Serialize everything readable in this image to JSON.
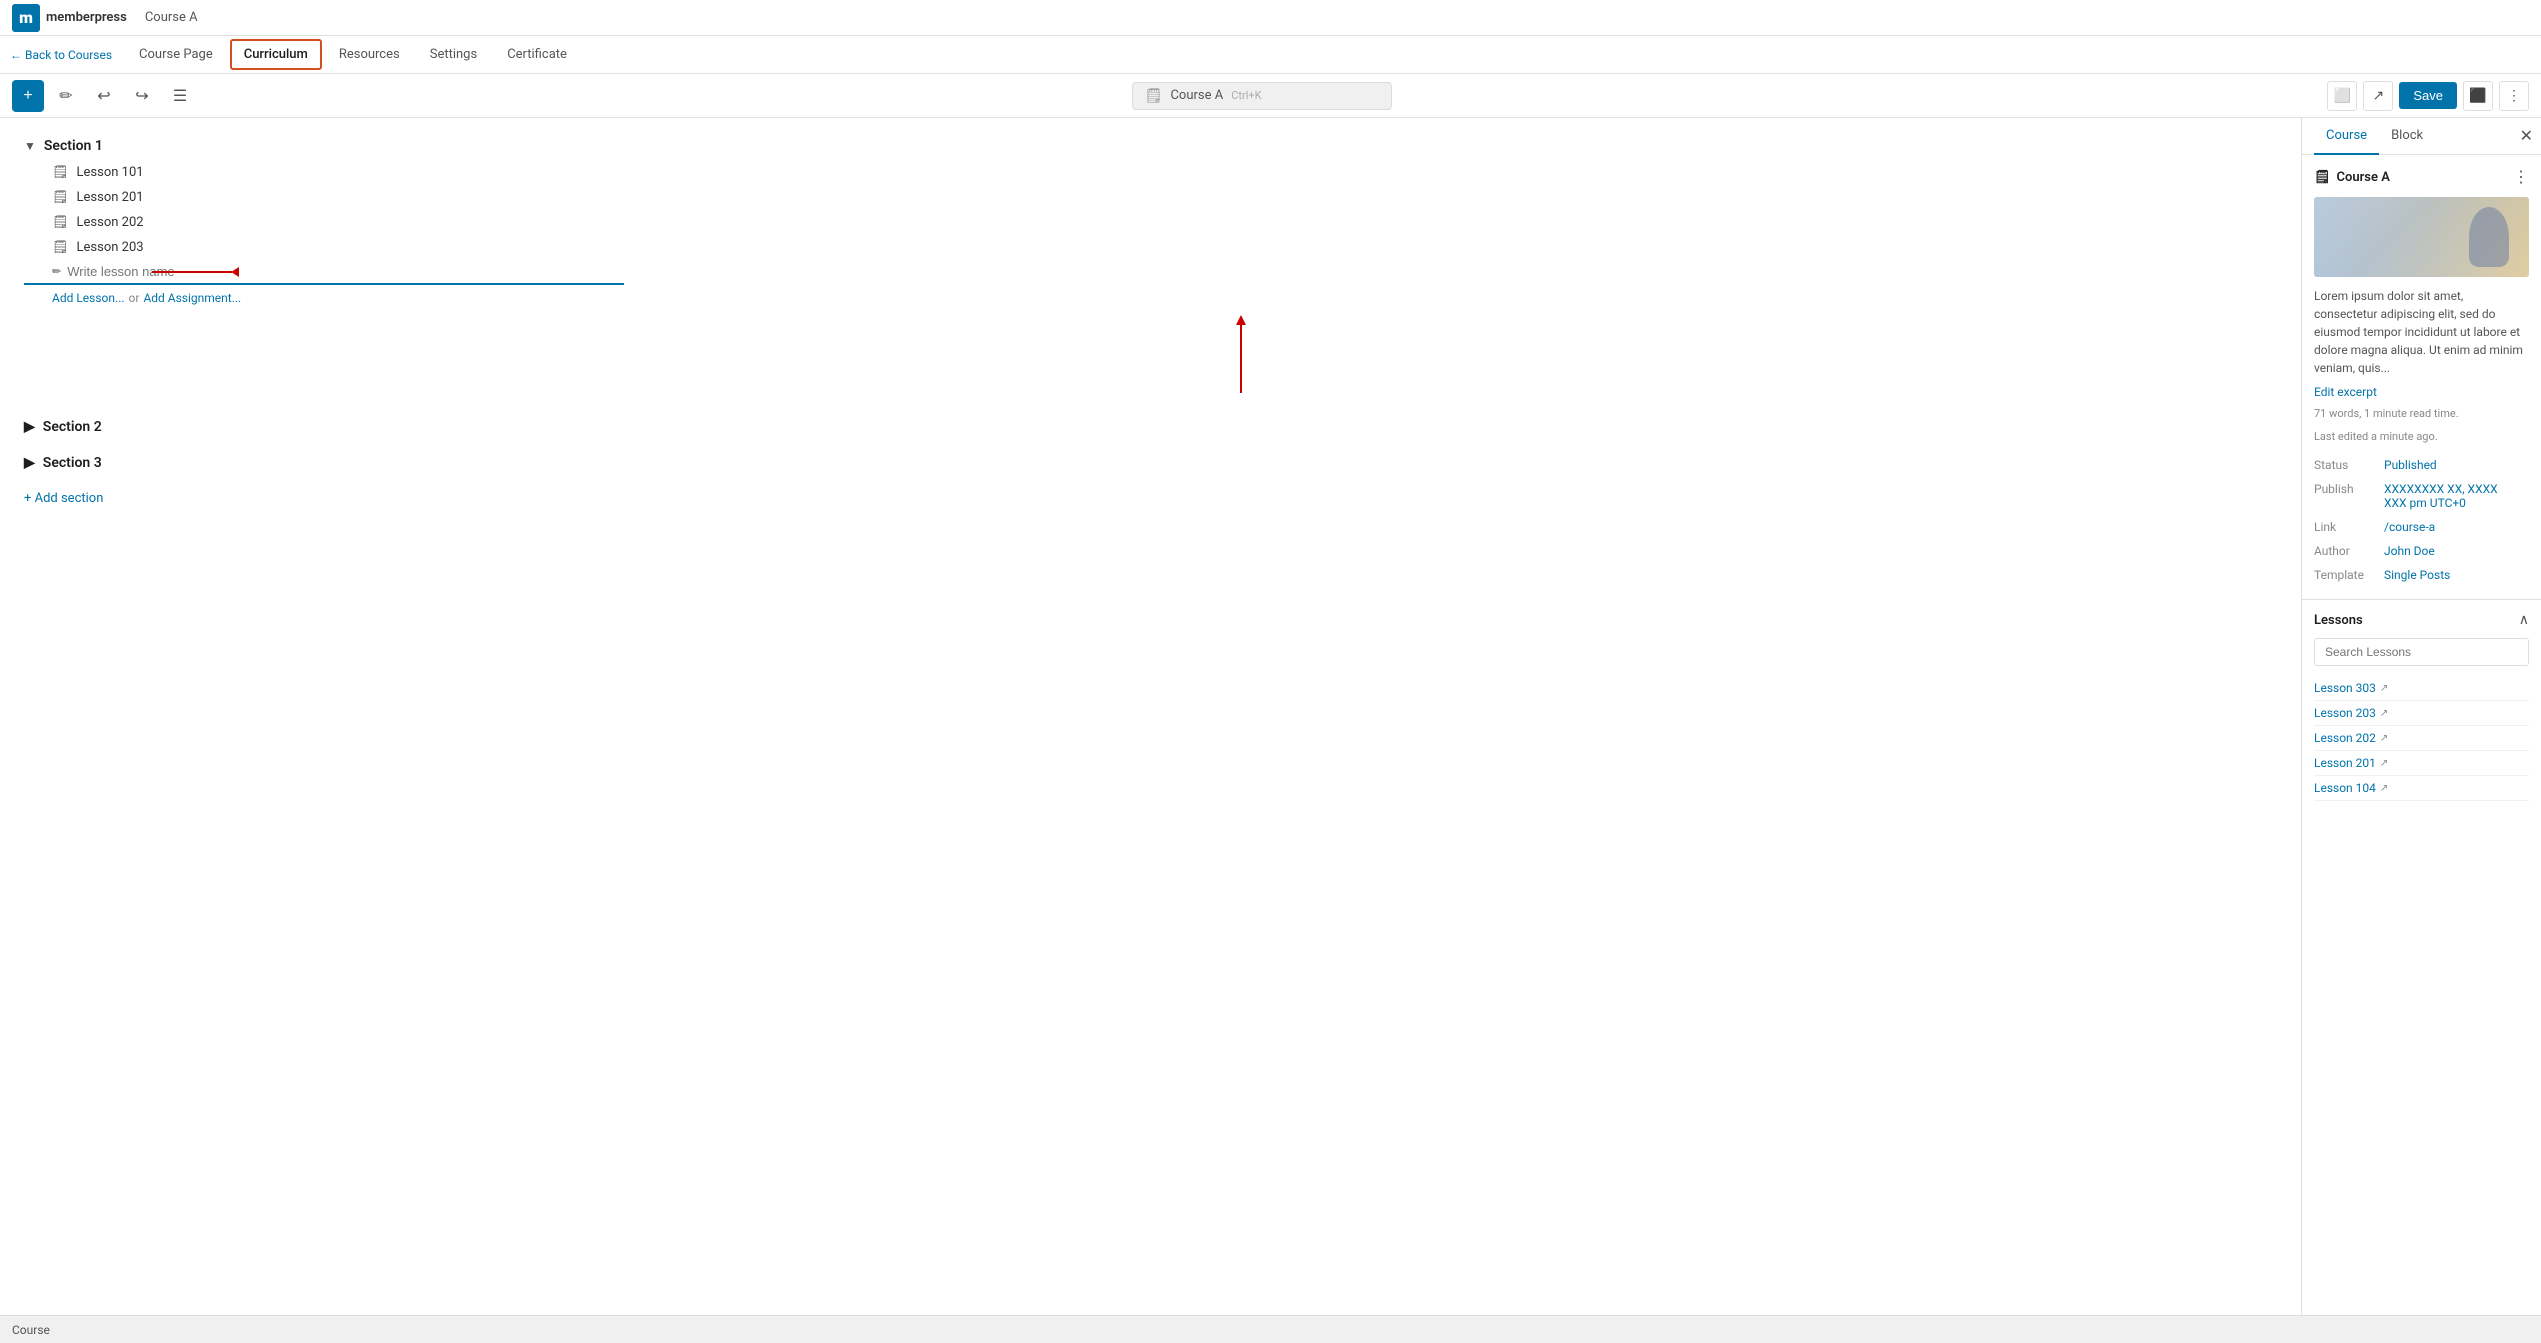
{
  "header": {
    "logo_letter": "m",
    "brand_name": "memberpress",
    "course_name": "Course A"
  },
  "nav": {
    "back_label": "← Back to Courses",
    "tabs": [
      {
        "id": "course-page",
        "label": "Course Page",
        "active": false
      },
      {
        "id": "curriculum",
        "label": "Curriculum",
        "active": true
      },
      {
        "id": "resources",
        "label": "Resources",
        "active": false
      },
      {
        "id": "settings",
        "label": "Settings",
        "active": false
      },
      {
        "id": "certificate",
        "label": "Certificate",
        "active": false
      }
    ]
  },
  "toolbar": {
    "title": "Course A",
    "shortcut": "Ctrl+K",
    "save_label": "Save"
  },
  "curriculum": {
    "sections": [
      {
        "id": "section-1",
        "label": "Section 1",
        "expanded": true,
        "lessons": [
          {
            "label": "Lesson 101"
          },
          {
            "label": "Lesson 201"
          },
          {
            "label": "Lesson 202"
          },
          {
            "label": "Lesson 203"
          }
        ],
        "new_lesson_placeholder": "Write lesson name",
        "add_lesson_label": "Add Lesson...",
        "or_label": "or",
        "add_assignment_label": "Add Assignment..."
      },
      {
        "id": "section-2",
        "label": "Section 2",
        "expanded": false,
        "lessons": []
      },
      {
        "id": "section-3",
        "label": "Section 3",
        "expanded": false,
        "lessons": []
      }
    ],
    "add_section_label": "+ Add section"
  },
  "right_panel": {
    "tabs": [
      {
        "label": "Course",
        "active": true
      },
      {
        "label": "Block",
        "active": false
      }
    ],
    "course_title": "Course A",
    "description": "Lorem ipsum dolor sit amet, consectetur adipiscing elit, sed do eiusmod tempor incididunt ut labore et dolore magna aliqua. Ut enim ad minim veniam, quis...",
    "edit_excerpt_label": "Edit excerpt",
    "word_count": "71 words, 1 minute read time.",
    "last_edited": "Last edited a minute ago.",
    "meta": {
      "status_label": "Status",
      "status_value": "Published",
      "publish_label": "Publish",
      "publish_value": "XXXXXXXX XX, XXXX\nXXX pm UTC+0",
      "link_label": "Link",
      "link_value": "/course-a",
      "author_label": "Author",
      "author_value": "John Doe",
      "template_label": "Template",
      "template_value": "Single Posts"
    },
    "lessons": {
      "title": "Lessons",
      "search_placeholder": "Search Lessons",
      "items": [
        {
          "label": "Lesson 303"
        },
        {
          "label": "Lesson 203"
        },
        {
          "label": "Lesson 202"
        },
        {
          "label": "Lesson 201"
        },
        {
          "label": "Lesson 104"
        }
      ]
    }
  },
  "status_bar": {
    "label": "Course"
  }
}
